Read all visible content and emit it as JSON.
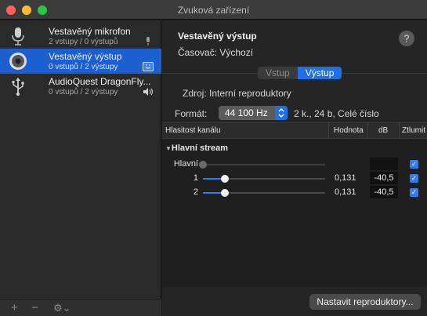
{
  "window": {
    "title": "Zvuková zařízení"
  },
  "sidebar": {
    "devices": [
      {
        "name": "Vestavěný mikrofon",
        "sub": "2 vstupy / 0 výstupů",
        "icon": "microphone-icon",
        "badge": "microphone-badge-icon"
      },
      {
        "name": "Vestavěný výstup",
        "sub": "0 vstupů / 2 výstupy",
        "icon": "speaker-icon",
        "badge": "finder-badge-icon"
      },
      {
        "name": "AudioQuest DragonFly...",
        "sub": "0 vstupů / 2 výstupy",
        "icon": "usb-icon",
        "badge": "speaker-volume-icon"
      }
    ],
    "bottom": {
      "add": "+",
      "remove": "−",
      "gear": "⚙⌄"
    }
  },
  "main": {
    "device_title": "Vestavěný výstup",
    "clock": "Časovač:  Výchozí",
    "help": "?",
    "tabs": [
      {
        "label": "Vstup",
        "active": false
      },
      {
        "label": "Výstup",
        "active": true
      }
    ],
    "source_label": "Zdroj:",
    "source_value": "Interní reproduktory",
    "format_label": "Formát:",
    "format_value": "44 100 Hz",
    "format_extra": "2 k., 24 b, Celé číslo",
    "table": {
      "headers": {
        "channel": "Hlasitost kanálu",
        "value": "Hodnota",
        "db": "dB",
        "mute": "Ztlumit"
      },
      "stream": "Hlavní stream",
      "rows": [
        {
          "label": "Hlavní",
          "value": "",
          "db": "",
          "level": 0.0,
          "muted": true
        },
        {
          "label": "1",
          "value": "0,131",
          "db": "-40,5",
          "level": 0.18,
          "muted": true
        },
        {
          "label": "2",
          "value": "0,131",
          "db": "-40,5",
          "level": 0.18,
          "muted": true
        }
      ]
    },
    "configure_speakers": "Nastavit reproduktory..."
  },
  "colors": {
    "accent": "#1f6fe5",
    "selection": "#1b5fd0"
  }
}
